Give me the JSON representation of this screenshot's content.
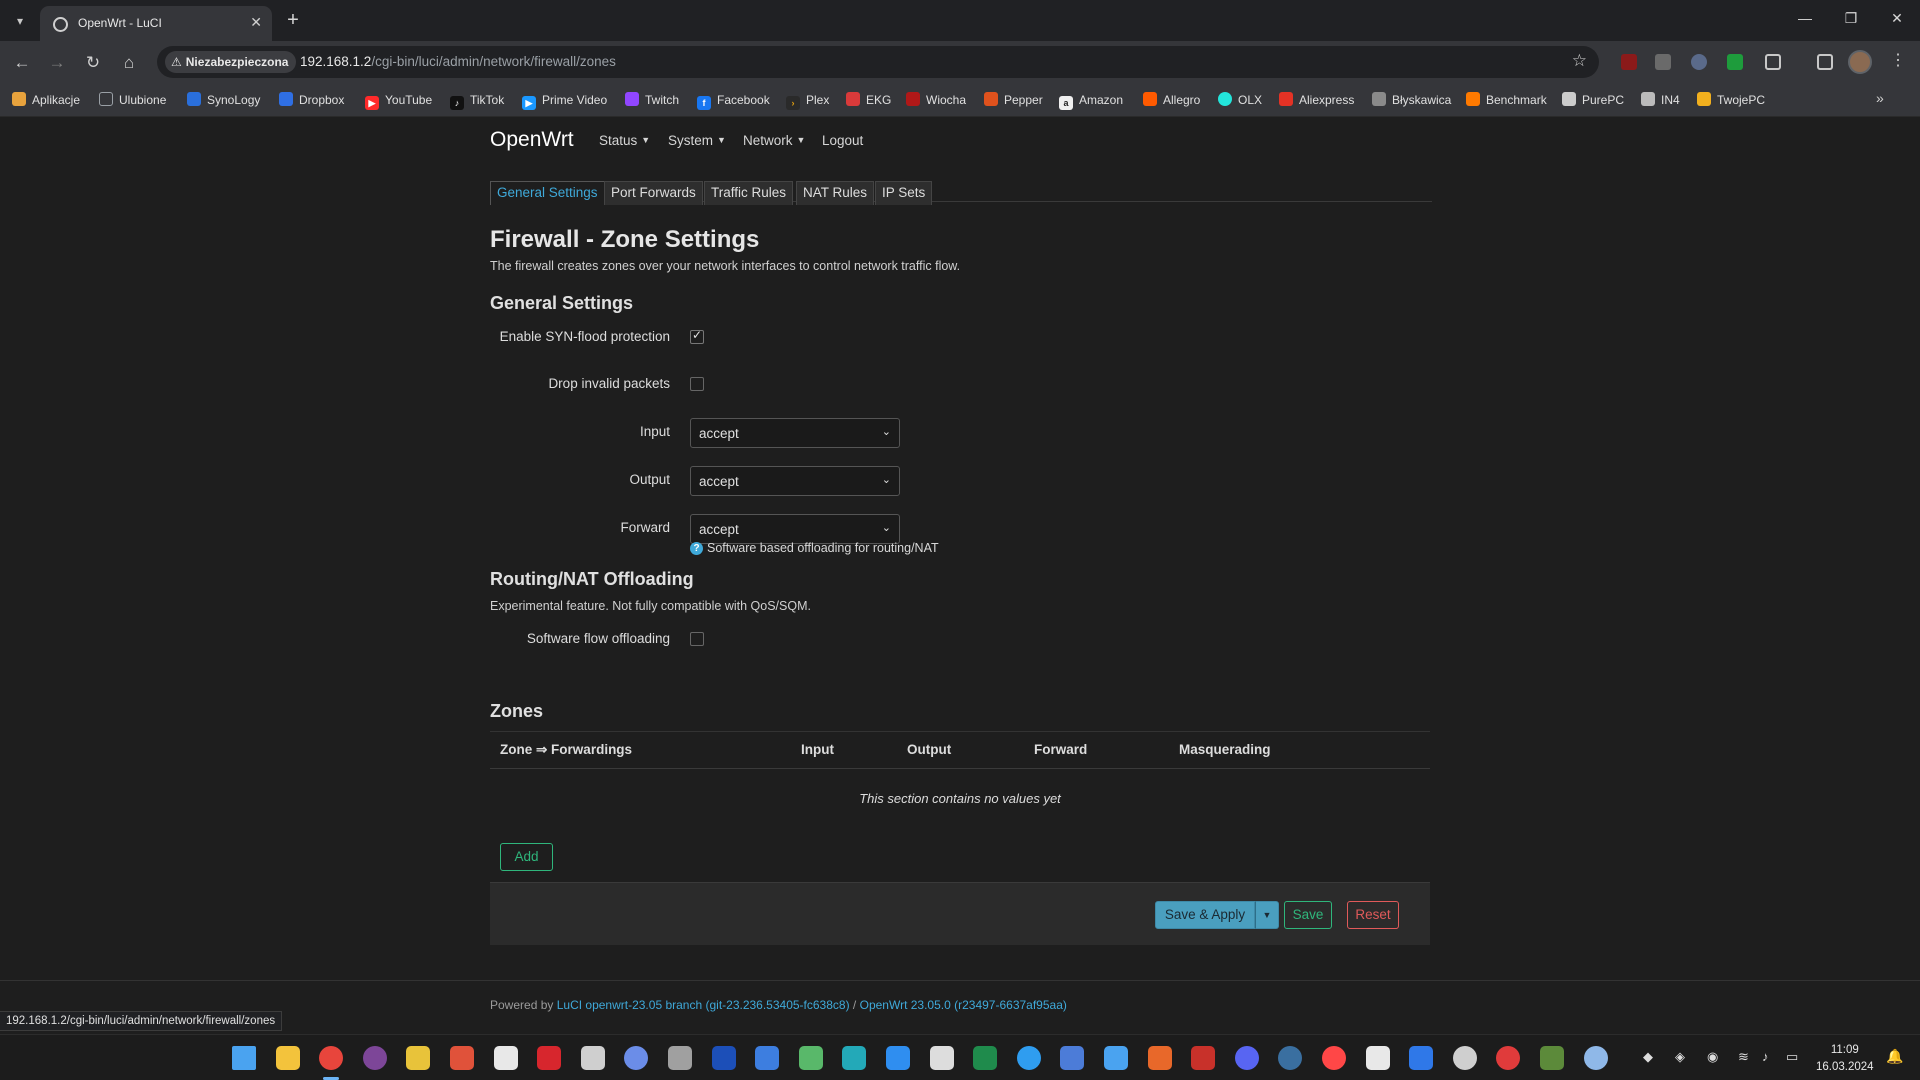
{
  "browser": {
    "tab_title": "OpenWrt - LuCI",
    "new_tab_symbol": "+",
    "security_chip": "Niezabezpieczona",
    "url_host": "192.168.1.2",
    "url_path": "/cgi-bin/luci/admin/network/firewall/zones",
    "status_url": "192.168.1.2/cgi-bin/luci/admin/network/firewall/zones",
    "bookmarks": [
      {
        "label": "Aplikacje",
        "icon": "apps-grid-icon",
        "color": "#e8a33d"
      },
      {
        "label": "Ulubione",
        "icon": "folder-icon",
        "color": "#9aa0a6"
      },
      {
        "label": "SynoLogy",
        "icon": "synology-icon",
        "color": "#2a6fdb"
      },
      {
        "label": "Dropbox",
        "icon": "dropbox-icon",
        "color": "#2f6fe4"
      },
      {
        "label": "YouTube",
        "icon": "youtube-icon",
        "color": "#ff2a2a"
      },
      {
        "label": "TikTok",
        "icon": "tiktok-icon",
        "color": "#111111"
      },
      {
        "label": "Prime Video",
        "icon": "prime-video-icon",
        "color": "#1a98ff"
      },
      {
        "label": "Twitch",
        "icon": "twitch-icon",
        "color": "#9146ff"
      },
      {
        "label": "Facebook",
        "icon": "facebook-icon",
        "color": "#1877f2"
      },
      {
        "label": "Plex",
        "icon": "plex-icon",
        "color": "#e5a00d"
      },
      {
        "label": "EKG",
        "icon": "ekg-icon",
        "color": "#d93a3a"
      },
      {
        "label": "Wiocha",
        "icon": "wiocha-icon",
        "color": "#b01818"
      },
      {
        "label": "Pepper",
        "icon": "pepper-icon",
        "color": "#e0521d"
      },
      {
        "label": "Amazon",
        "icon": "amazon-icon",
        "color": "#f0f0f0"
      },
      {
        "label": "Allegro",
        "icon": "allegro-icon",
        "color": "#ff5a00"
      },
      {
        "label": "OLX",
        "icon": "olx-icon",
        "color": "#23e5db"
      },
      {
        "label": "Aliexpress",
        "icon": "aliexpress-icon",
        "color": "#e43225"
      },
      {
        "label": "Błyskawica",
        "icon": "blyskawica-icon",
        "color": "#8a8a8a"
      },
      {
        "label": "Benchmark",
        "icon": "benchmark-icon",
        "color": "#ff7a00"
      },
      {
        "label": "PurePC",
        "icon": "purepc-icon",
        "color": "#cccccc"
      },
      {
        "label": "IN4",
        "icon": "in4-icon",
        "color": "#bbbbbb"
      },
      {
        "label": "TwojePC",
        "icon": "twojepc-icon",
        "color": "#f2b01e"
      }
    ]
  },
  "luci": {
    "brand": "OpenWrt",
    "nav": {
      "status": "Status",
      "system": "System",
      "network": "Network",
      "logout": "Logout"
    },
    "tabs": [
      "General Settings",
      "Port Forwards",
      "Traffic Rules",
      "NAT Rules",
      "IP Sets"
    ],
    "title": "Firewall - Zone Settings",
    "description": "The firewall creates zones over your network interfaces to control network traffic flow.",
    "general": {
      "heading": "General Settings",
      "syn_label": "Enable SYN-flood protection",
      "syn_checked": true,
      "drop_label": "Drop invalid packets",
      "drop_checked": false,
      "input_label": "Input",
      "input_value": "accept",
      "output_label": "Output",
      "output_value": "accept",
      "forward_label": "Forward",
      "forward_value": "accept"
    },
    "offload": {
      "heading": "Routing/NAT Offloading",
      "description": "Experimental feature. Not fully compatible with QoS/SQM.",
      "sw_label": "Software flow offloading",
      "sw_checked": false,
      "help": "Software based offloading for routing/NAT"
    },
    "zones": {
      "heading": "Zones",
      "columns": [
        "Zone ⇒ Forwardings",
        "Input",
        "Output",
        "Forward",
        "Masquerading"
      ],
      "empty": "This section contains no values yet",
      "add": "Add"
    },
    "actions": {
      "save_apply": "Save & Apply",
      "save": "Save",
      "reset": "Reset"
    },
    "footer": {
      "powered": "Powered by",
      "luci_link": "LuCI openwrt-23.05 branch (git-23.236.53405-fc638c8)",
      "sep": "/",
      "openwrt_link": "OpenWrt 23.05.0 (r23497-6637af95aa)"
    }
  },
  "taskbar": {
    "apps": [
      {
        "icon": "windows-start-icon",
        "color": "#4aa3f0"
      },
      {
        "icon": "file-explorer-icon",
        "color": "#f3c33c"
      },
      {
        "icon": "chrome-icon",
        "color": "#e8453c"
      },
      {
        "icon": "tor-browser-icon",
        "color": "#7d4698"
      },
      {
        "icon": "app-yellow-icon",
        "color": "#e8c33a"
      },
      {
        "icon": "app-red-arrow-icon",
        "color": "#e0523a"
      },
      {
        "icon": "notepad-icon",
        "color": "#e8e8e8"
      },
      {
        "icon": "app-red-bug-icon",
        "color": "#d7262d"
      },
      {
        "icon": "app-aperture-icon",
        "color": "#cfcfcf"
      },
      {
        "icon": "app-circle-blue-icon",
        "color": "#6b8de8"
      },
      {
        "icon": "app-gray-bar-icon",
        "color": "#a0a0a0"
      },
      {
        "icon": "app-blue-square-icon",
        "color": "#1c4fb8"
      },
      {
        "icon": "app-blue-tall-icon",
        "color": "#3d7ee0"
      },
      {
        "icon": "app-green-image-icon",
        "color": "#59b86a"
      },
      {
        "icon": "app-teal-icon",
        "color": "#23a9b8"
      },
      {
        "icon": "onedrive-icon",
        "color": "#2f8ef0"
      },
      {
        "icon": "app-doc-icon",
        "color": "#dddddd"
      },
      {
        "icon": "excel-icon",
        "color": "#1f8b4c"
      },
      {
        "icon": "app-blue-circle-icon",
        "color": "#2f9df0"
      },
      {
        "icon": "app-network-icon",
        "color": "#4c7cd8"
      },
      {
        "icon": "app-windows-icon",
        "color": "#4aa3f0"
      },
      {
        "icon": "app-orange-icon",
        "color": "#e8682a"
      },
      {
        "icon": "app-rust-icon",
        "color": "#c8312a"
      },
      {
        "icon": "discord-icon",
        "color": "#5865f2"
      },
      {
        "icon": "steam-icon",
        "color": "#3a6fa0"
      },
      {
        "icon": "ea-icon",
        "color": "#ff4747"
      },
      {
        "icon": "epic-games-icon",
        "color": "#e8e8e8"
      },
      {
        "icon": "app-blue-b-icon",
        "color": "#2f78e8"
      },
      {
        "icon": "app-ring-icon",
        "color": "#cfcfcf"
      },
      {
        "icon": "app-red-circle-icon",
        "color": "#e03b3b"
      },
      {
        "icon": "minecraft-icon",
        "color": "#5c8a3a"
      },
      {
        "icon": "settings-gear-icon",
        "color": "#8fb8e8"
      }
    ],
    "time": "11:09",
    "date": "16.03.2024"
  }
}
